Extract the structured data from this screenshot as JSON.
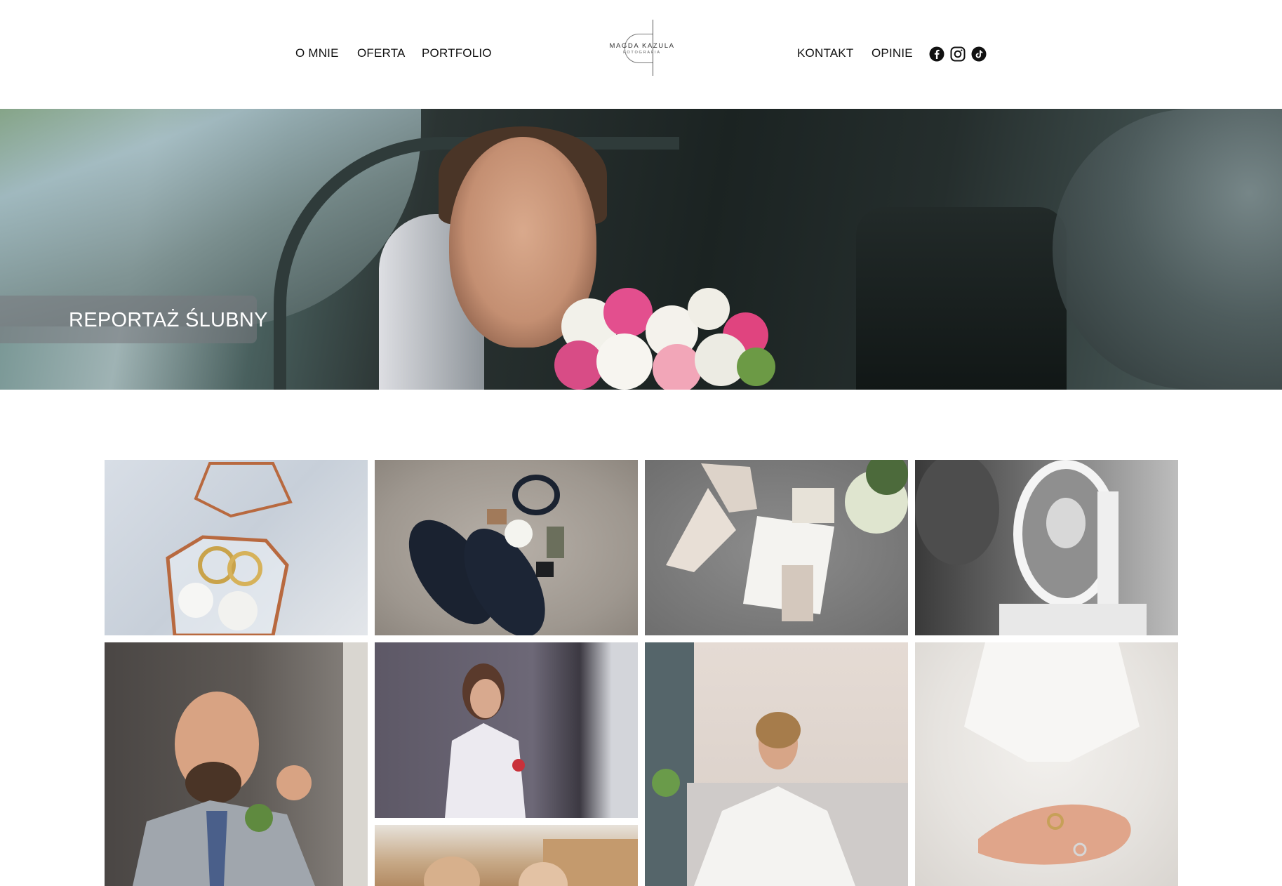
{
  "header": {
    "nav_left": [
      "O MNIE",
      "OFERTA",
      "PORTFOLIO"
    ],
    "nav_right": [
      "KONTAKT",
      "OPINIE"
    ],
    "logo": {
      "name": "MAGDA KAZULA",
      "subtitle": "FOTOGRAFIA"
    },
    "social_icons": [
      "facebook-icon",
      "instagram-icon",
      "tiktok-icon"
    ]
  },
  "hero": {
    "title": "REPORTAŻ ŚLUBNY"
  },
  "gallery": {
    "images": [
      "wedding-rings-in-glass-box",
      "groom-shoes-and-accessories",
      "bride-shoes-and-invitation",
      "bride-in-mirror",
      "groom-with-cufflinks",
      "bride-with-perfume",
      "groom-getting-ready",
      "bride-putting-on-shoes",
      "ring-in-bride-hand"
    ]
  },
  "colors": {
    "text": "#111111",
    "background": "#ffffff",
    "hero_label_bg": "#787880"
  }
}
